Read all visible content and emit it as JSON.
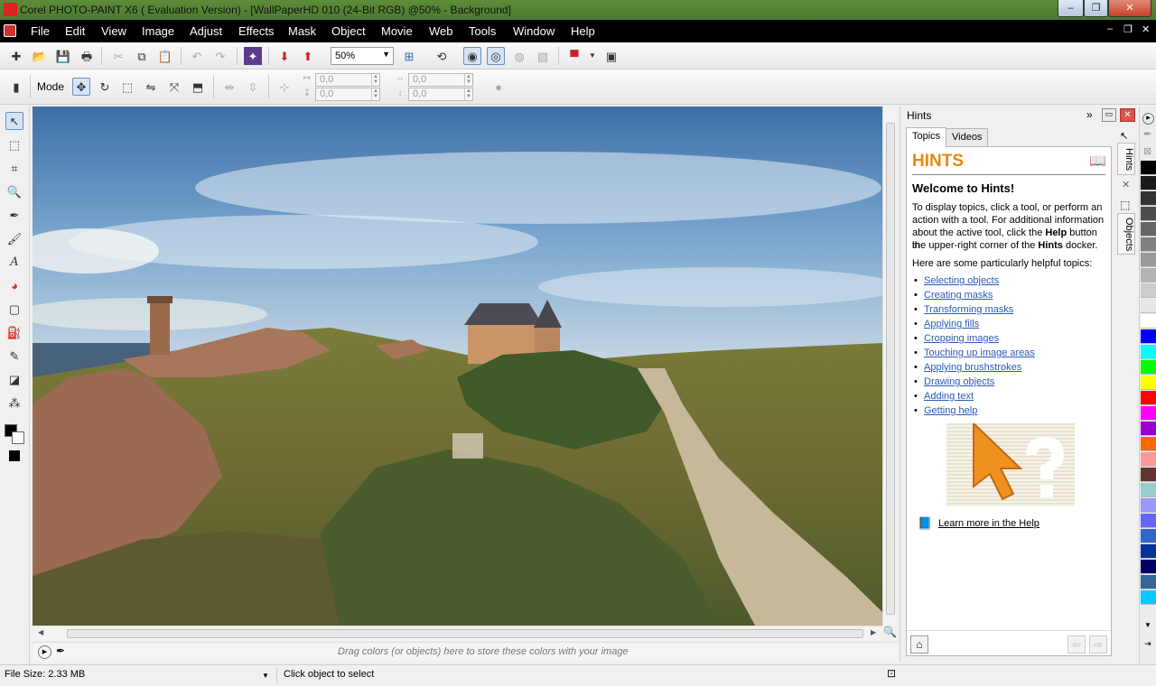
{
  "window": {
    "title": "Corel PHOTO-PAINT X6 ( Evaluation Version) - [WallPaperHD 010 (24-Bit RGB) @50% - Background]",
    "minimize": "‒",
    "restore": "❐",
    "close": "✕"
  },
  "menu": {
    "items": [
      "File",
      "Edit",
      "View",
      "Image",
      "Adjust",
      "Effects",
      "Mask",
      "Object",
      "Movie",
      "Web",
      "Tools",
      "Window",
      "Help"
    ],
    "mdi": [
      "–",
      "❐",
      "✕"
    ]
  },
  "toolbar": {
    "zoom": "50%"
  },
  "propertybar": {
    "mode_label": "Mode",
    "x1": "0,0",
    "y1": "0,0",
    "w": "0,0",
    "h": "0,0"
  },
  "colortray": {
    "message": "Drag colors (or objects) here to store these colors with your image"
  },
  "status": {
    "file_size": "File Size: 2.33 MB",
    "hint": "Click object to select"
  },
  "hints": {
    "docker_title": "Hints",
    "tabs": [
      "Topics",
      "Videos"
    ],
    "heading": "HINTS",
    "welcome": "Welcome to Hints!",
    "intro_1": "To display topics, click a tool, or perform an",
    "intro_2": "action with a tool. For additional information",
    "intro_3a": "about the active tool, click the ",
    "intro_3b": "Help",
    "intro_3c": " button in",
    "intro_4a": "the upper-right corner of the ",
    "intro_4b": "Hints",
    "intro_4c": " docker.",
    "helpful": "Here are some particularly helpful topics:",
    "topics": [
      "Selecting objects",
      "Creating masks",
      "Transforming masks",
      "Applying fills",
      "Cropping images",
      "Touching up image areas",
      "Applying brushstrokes",
      "Drawing objects",
      "Adding text",
      "Getting help"
    ],
    "learn_more": "Learn more in the Help"
  },
  "side_tabs": [
    "Hints",
    "Objects"
  ],
  "palette": [
    "#000000",
    "#1a1a1a",
    "#333333",
    "#4d4d4d",
    "#666666",
    "#808080",
    "#999999",
    "#b3b3b3",
    "#cccccc",
    "#e6e6e6",
    "#ffffff",
    "#0000ff",
    "#00ffff",
    "#00ff00",
    "#ffff00",
    "#ff0000",
    "#ff00ff",
    "#9900cc",
    "#ff6600",
    "#ff9999",
    "#663333",
    "#99cccc",
    "#9999ff",
    "#6666ff",
    "#3366cc",
    "#003399",
    "#000066",
    "#336699",
    "#00ccff"
  ]
}
